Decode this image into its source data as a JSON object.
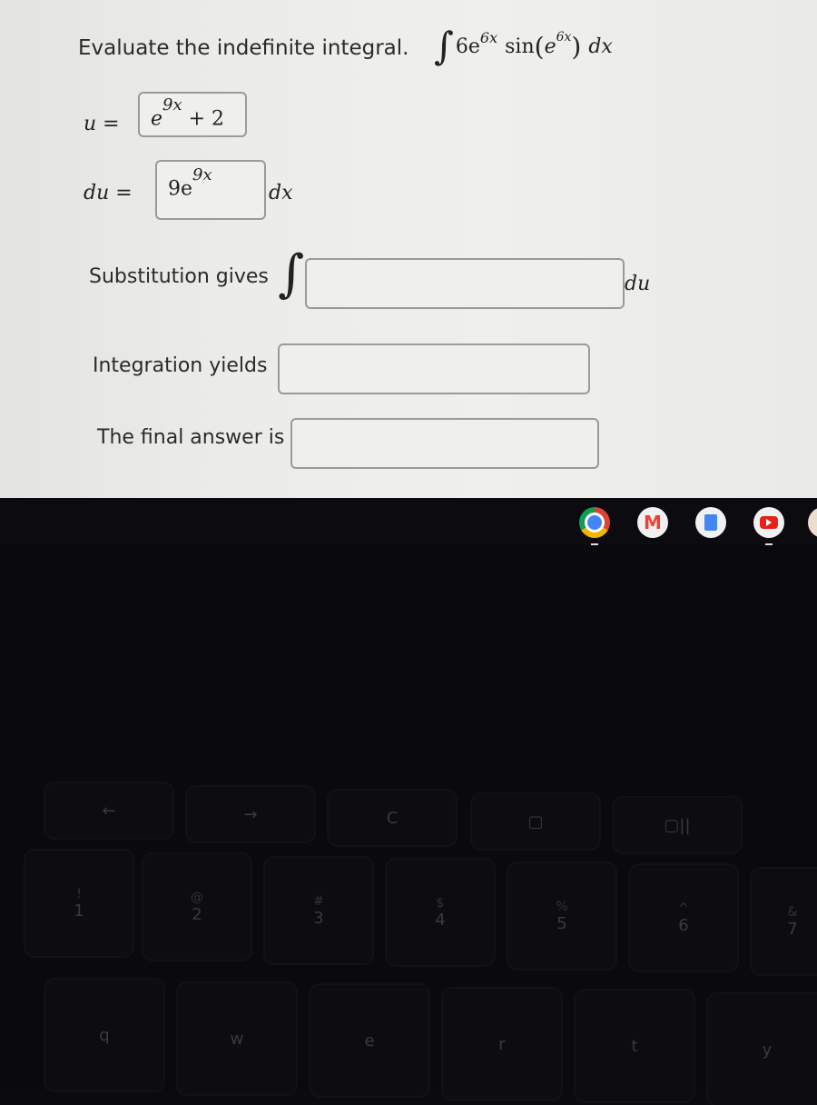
{
  "problem": {
    "prompt": "Evaluate the indefinite integral.",
    "integrand": {
      "coef": "6e",
      "exp1": "6x",
      "func": "sin",
      "inner_base": "e",
      "inner_exp": "6x",
      "differential": "dx"
    }
  },
  "u_row": {
    "label": "u =",
    "value_base": "e",
    "value_exp": "9x",
    "value_rest": " + 2"
  },
  "du_row": {
    "label": "du =",
    "value_base": "9e",
    "value_exp": "9x",
    "suffix": "dx"
  },
  "substitution": {
    "label": "Substitution gives",
    "value": "",
    "suffix": "du"
  },
  "integration": {
    "label": "Integration yields",
    "value": ""
  },
  "final": {
    "label": "The final answer is",
    "value": ""
  },
  "shelf": {
    "apps": [
      {
        "name": "chrome-icon",
        "running": true
      },
      {
        "name": "gmail-icon",
        "running": false
      },
      {
        "name": "docs-icon",
        "running": false
      },
      {
        "name": "youtube-icon",
        "running": true
      }
    ]
  },
  "keyboard": {
    "function_row": [
      "←",
      "→",
      "C",
      "▢",
      "▢||"
    ],
    "number_row": [
      {
        "top": "!",
        "bottom": "1"
      },
      {
        "top": "@",
        "bottom": "2"
      },
      {
        "top": "#",
        "bottom": "3"
      },
      {
        "top": "$",
        "bottom": "4"
      },
      {
        "top": "%",
        "bottom": "5"
      },
      {
        "top": "^",
        "bottom": "6"
      },
      {
        "top": "&",
        "bottom": "7"
      }
    ],
    "letter_row": [
      "q",
      "w",
      "e",
      "r",
      "t",
      "y"
    ]
  }
}
